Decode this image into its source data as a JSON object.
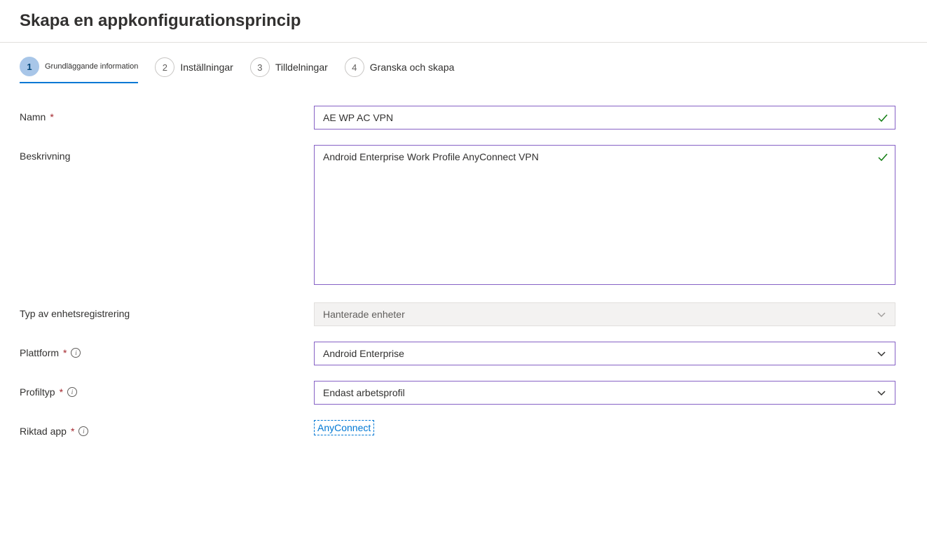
{
  "header": {
    "title": "Skapa en appkonfigurationsprincip"
  },
  "wizard": {
    "steps": [
      {
        "num": "1",
        "label": "Grundläggande information"
      },
      {
        "num": "2",
        "label": "Inställningar"
      },
      {
        "num": "3",
        "label": "Tilldelningar"
      },
      {
        "num": "4",
        "label": "Granska och skapa"
      }
    ]
  },
  "form": {
    "name_label": "Namn",
    "name_value": "AE WP AC VPN",
    "description_label": "Beskrivning",
    "description_value": "Android Enterprise Work Profile AnyConnect VPN",
    "enrollment_label": "Typ av enhetsregistrering",
    "enrollment_value": "Hanterade enheter",
    "platform_label": "Plattform",
    "platform_value": "Android Enterprise",
    "profiletype_label": "Profiltyp",
    "profiletype_value": "Endast arbetsprofil",
    "targetedapp_label": "Riktad app",
    "targetedapp_value": "AnyConnect"
  }
}
